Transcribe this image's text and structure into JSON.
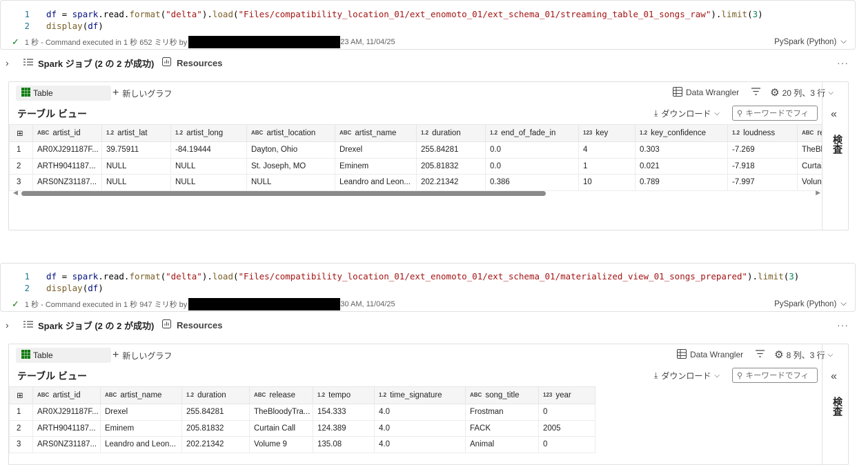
{
  "cells": [
    {
      "code": {
        "line1_num": "1",
        "line1": {
          "a": "df",
          "b": " = ",
          "c": "spark",
          "d": ".read.",
          "e": "format",
          "f": "(",
          "g": "\"delta\"",
          "h": ").",
          "i": "load",
          "j": "(",
          "k": "\"Files/compatibility_location_01/ext_enomoto_01/ext_schema_01/streaming_table_01_songs_raw\"",
          "l": ").",
          "m": "limit",
          "n": "(",
          "o": "3",
          "p": ")"
        },
        "line2_num": "2",
        "line2": {
          "a": "display",
          "b": "(",
          "c": "df",
          "d": ")"
        }
      },
      "status": {
        "text": "1 秒 - Command executed in 1 秒 652 ミリ秒 by",
        "time": "23 AM, 11/04/25"
      },
      "language": "PySpark (Python)",
      "jobs": {
        "label": "Spark ジョブ (2 の 2 が成功)",
        "resources": "Resources"
      },
      "output": {
        "tab_table": "Table",
        "tab_new": "新しいグラフ",
        "data_wrangler": "Data Wrangler",
        "cols_rows": "20 列、3 行",
        "table_view": "テーブル ビュー",
        "download": "ダウンロード",
        "search_placeholder": "キーワードでフィ",
        "inspect": "検査",
        "columns": [
          {
            "type": "ABC",
            "name": "artist_id"
          },
          {
            "type": "1.2",
            "name": "artist_lat"
          },
          {
            "type": "1.2",
            "name": "artist_long"
          },
          {
            "type": "ABC",
            "name": "artist_location"
          },
          {
            "type": "ABC",
            "name": "artist_name"
          },
          {
            "type": "1.2",
            "name": "duration"
          },
          {
            "type": "1.2",
            "name": "end_of_fade_in"
          },
          {
            "type": "123",
            "name": "key"
          },
          {
            "type": "1.2",
            "name": "key_confidence"
          },
          {
            "type": "1.2",
            "name": "loudness"
          },
          {
            "type": "ABC",
            "name": "rel"
          }
        ],
        "rows": [
          [
            "1",
            "AR0XJ291187F...",
            "39.75911",
            "-84.19444",
            "Dayton, Ohio",
            "Drexel",
            "255.84281",
            "0.0",
            "4",
            "0.303",
            "-7.269",
            "TheBl"
          ],
          [
            "2",
            "ARTH9041187...",
            "NULL",
            "NULL",
            "St. Joseph, MO",
            "Eminem",
            "205.81832",
            "0.0",
            "1",
            "0.021",
            "-7.918",
            "Curtai"
          ],
          [
            "3",
            "ARS0NZ31187...",
            "NULL",
            "NULL",
            "NULL",
            "Leandro and Leon...",
            "202.21342",
            "0.386",
            "10",
            "0.789",
            "-7.997",
            "Volun"
          ]
        ]
      }
    },
    {
      "code": {
        "line1_num": "1",
        "line1": {
          "a": "df",
          "b": " = ",
          "c": "spark",
          "d": ".read.",
          "e": "format",
          "f": "(",
          "g": "\"delta\"",
          "h": ").",
          "i": "load",
          "j": "(",
          "k": "\"Files/compatibility_location_01/ext_enomoto_01/ext_schema_01/materialized_view_01_songs_prepared\"",
          "l": ").",
          "m": "limit",
          "n": "(",
          "o": "3",
          "p": ")"
        },
        "line2_num": "2",
        "line2": {
          "a": "display",
          "b": "(",
          "c": "df",
          "d": ")"
        }
      },
      "status": {
        "text": "1 秒 - Command executed in 1 秒 947 ミリ秒 by",
        "time": "30 AM, 11/04/25"
      },
      "language": "PySpark (Python)",
      "jobs": {
        "label": "Spark ジョブ (2 の 2 が成功)",
        "resources": "Resources"
      },
      "output": {
        "tab_table": "Table",
        "tab_new": "新しいグラフ",
        "data_wrangler": "Data Wrangler",
        "cols_rows": "8 列、3 行",
        "table_view": "テーブル ビュー",
        "download": "ダウンロード",
        "search_placeholder": "キーワードでフィ",
        "inspect": "検査",
        "columns": [
          {
            "type": "ABC",
            "name": "artist_id"
          },
          {
            "type": "ABC",
            "name": "artist_name"
          },
          {
            "type": "1.2",
            "name": "duration"
          },
          {
            "type": "ABC",
            "name": "release"
          },
          {
            "type": "1.2",
            "name": "tempo"
          },
          {
            "type": "1.2",
            "name": "time_signature"
          },
          {
            "type": "ABC",
            "name": "song_title"
          },
          {
            "type": "123",
            "name": "year"
          }
        ],
        "rows": [
          [
            "1",
            "AR0XJ291187F...",
            "Drexel",
            "255.84281",
            "TheBloodyTra...",
            "154.333",
            "4.0",
            "Frostman",
            "0"
          ],
          [
            "2",
            "ARTH9041187...",
            "Eminem",
            "205.81832",
            "Curtain Call",
            "124.389",
            "4.0",
            "FACK",
            "2005"
          ],
          [
            "3",
            "ARS0NZ31187...",
            "Leandro and Leon...",
            "202.21342",
            "Volume 9",
            "135.08",
            "4.0",
            "Animal",
            "0"
          ]
        ]
      }
    }
  ]
}
